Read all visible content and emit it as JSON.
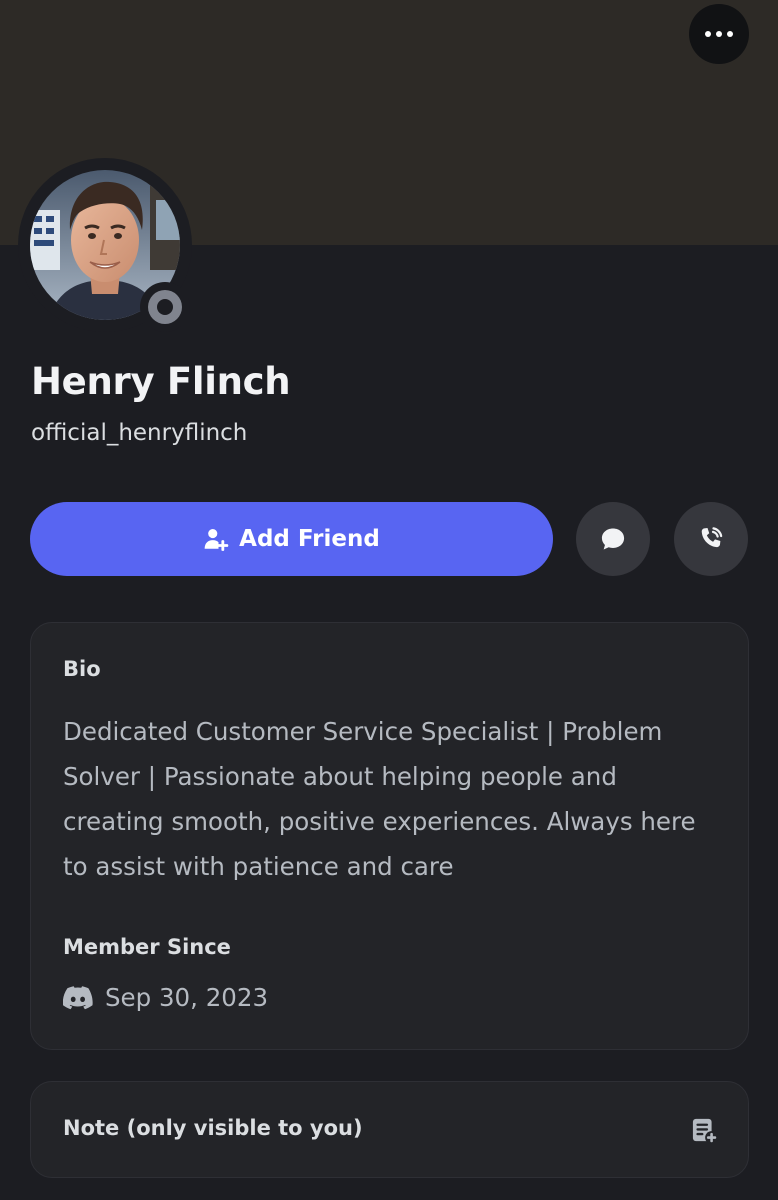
{
  "profile": {
    "display_name": "Henry Flinch",
    "username": "official_henryflinch",
    "status": "offline"
  },
  "actions": {
    "add_friend_label": "Add Friend",
    "message_icon": "chat-bubble-icon",
    "call_icon": "phone-call-icon",
    "more_icon": "ellipsis-icon"
  },
  "bio": {
    "heading": "Bio",
    "lines": [
      "Dedicated Customer Service Specialist | Problem",
      "Solver | Passionate about helping people and",
      "creating smooth, positive experiences. Always here",
      "to assist with patience and care"
    ]
  },
  "member_since": {
    "heading": "Member Since",
    "icon": "discord-icon",
    "date": "Sep 30, 2023"
  },
  "note": {
    "label": "Note (only visible to you)",
    "icon": "note-add-icon"
  },
  "colors": {
    "accent": "#5865f2",
    "background": "#1c1d22",
    "banner": "#2d2a26",
    "card": "#232428",
    "status_offline": "#80848e"
  }
}
